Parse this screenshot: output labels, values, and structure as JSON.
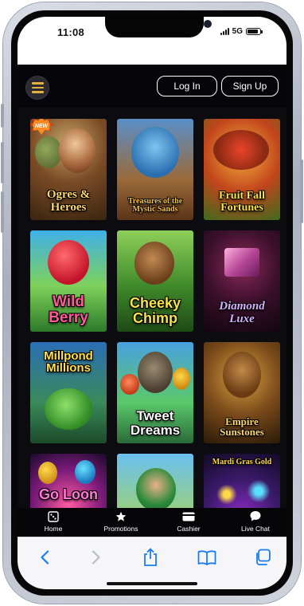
{
  "status_bar": {
    "time": "11:08",
    "network": "5G",
    "battery_level": 0.85
  },
  "header": {
    "menu_icon": "hamburger-menu-icon",
    "login_label": "Log In",
    "signup_label": "Sign Up",
    "accent": "#e2b23e"
  },
  "games": [
    {
      "title": "Ogres & Heroes",
      "badge": "NEW"
    },
    {
      "title": "Treasures of the Mystic Sands"
    },
    {
      "title": "Fruit Fall Fortunes"
    },
    {
      "title": "Wild Berry"
    },
    {
      "title": "Cheeky Chimp"
    },
    {
      "title": "Diamond Luxe"
    },
    {
      "title": "Millpond Millions"
    },
    {
      "title": "Tweet Dreams"
    },
    {
      "title": "Empire Sunstones"
    },
    {
      "title": "Go Loon"
    },
    {
      "title": ""
    },
    {
      "title": "Mardi Gras Gold"
    }
  ],
  "bottom_nav": [
    {
      "label": "Home",
      "icon": "dice-icon"
    },
    {
      "label": "Promotions",
      "icon": "star-icon"
    },
    {
      "label": "Cashier",
      "icon": "card-icon"
    },
    {
      "label": "Live Chat",
      "icon": "chat-icon"
    }
  ],
  "browser": {
    "buttons": [
      "back-arrow-icon",
      "forward-arrow-icon",
      "share-icon",
      "bookmarks-icon",
      "tabs-icon"
    ],
    "accent": "#1a7cf2"
  }
}
